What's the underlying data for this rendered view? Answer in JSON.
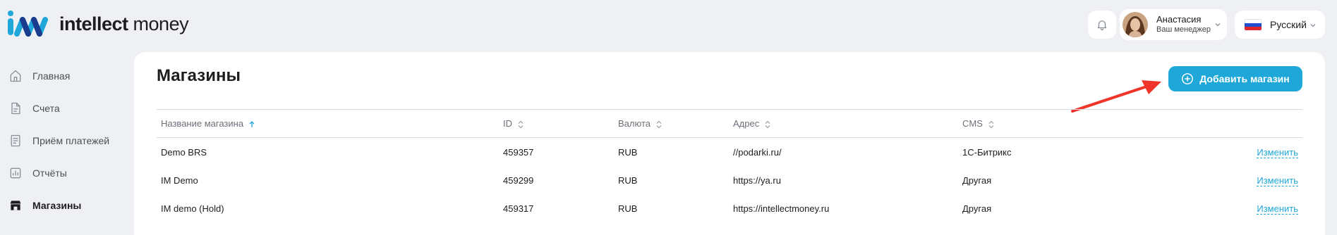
{
  "brand": {
    "name_bold": "intellect",
    "name_light": "money"
  },
  "header": {
    "user_name": "Анастасия",
    "user_role": "Ваш менеджер",
    "language": "Русский"
  },
  "sidebar": {
    "items": [
      {
        "label": "Главная",
        "icon": "home-icon"
      },
      {
        "label": "Счета",
        "icon": "document-icon"
      },
      {
        "label": "Приём платежей",
        "icon": "payment-list-icon"
      },
      {
        "label": "Отчёты",
        "icon": "chart-icon"
      },
      {
        "label": "Магазины",
        "icon": "store-icon",
        "active": true
      }
    ]
  },
  "main": {
    "title": "Магазины",
    "add_button": "Добавить магазин",
    "columns": [
      "Название магазина",
      "ID",
      "Валюта",
      "Адрес",
      "CMS"
    ],
    "rows": [
      {
        "name": "Demo BRS",
        "id": "459357",
        "currency": "RUB",
        "address": "//podarki.ru/",
        "cms": "1С-Битрикс",
        "action": "Изменить"
      },
      {
        "name": "IM Demo",
        "id": "459299",
        "currency": "RUB",
        "address": "https://ya.ru",
        "cms": "Другая",
        "action": "Изменить"
      },
      {
        "name": "IM demo (Hold)",
        "id": "459317",
        "currency": "RUB",
        "address": "https://intellectmoney.ru",
        "cms": "Другая",
        "action": "Изменить"
      }
    ]
  },
  "colors": {
    "accent": "#1fa7da",
    "arrow": "#f0342a",
    "background": "#eef0f3"
  }
}
